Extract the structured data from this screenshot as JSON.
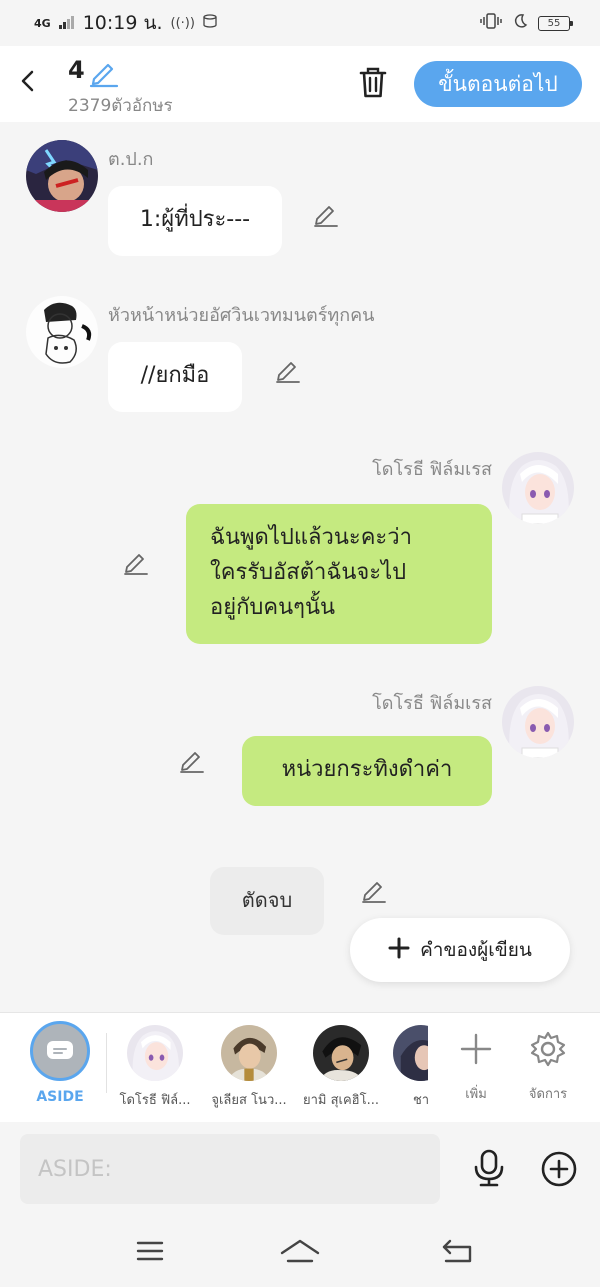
{
  "status_bar": {
    "network": "4G",
    "time": "10:19 น.",
    "battery": "55"
  },
  "header": {
    "count": "4",
    "char_count": "2379ตัวอักษร",
    "next_label": "ขั้นตอนต่อไป"
  },
  "messages": [
    {
      "sender": "ต.ป.ก",
      "text": "1:ผู้ที่ประ---"
    },
    {
      "sender": "หัวหน้าหน่วยอัศวินเวทมนตร์ทุกคน",
      "text": "//ยกมือ"
    },
    {
      "sender": "โดโรธี ฟิล์มเรส",
      "lines": [
        "ฉันพูดไปแล้วนะคะว่า",
        "ใครรับอัสต้าฉันจะไป",
        "อยู่กับคนๆนั้น"
      ]
    },
    {
      "sender": "โดโรธี ฟิล์มเรส",
      "text": "หน่วยกระทิงดำค่า"
    }
  ],
  "end_label": "ตัดจบ",
  "add_speech_label": "คำของผู้เขียน",
  "characters": {
    "aside_label": "ASIDE",
    "items": [
      {
        "name": "โดโรธี ฟิล์..."
      },
      {
        "name": "จูเลียส โนว..."
      },
      {
        "name": "ยามิ สุเคฮิโ..."
      },
      {
        "name": "ชา"
      }
    ],
    "add_label": "เพิ่ม",
    "manage_label": "จัดการ"
  },
  "input": {
    "placeholder": "ASIDE:"
  },
  "colors": {
    "accent": "#5aa6ee",
    "right_bubble": "#c5ea80",
    "left_bubble": "#ffffff"
  }
}
